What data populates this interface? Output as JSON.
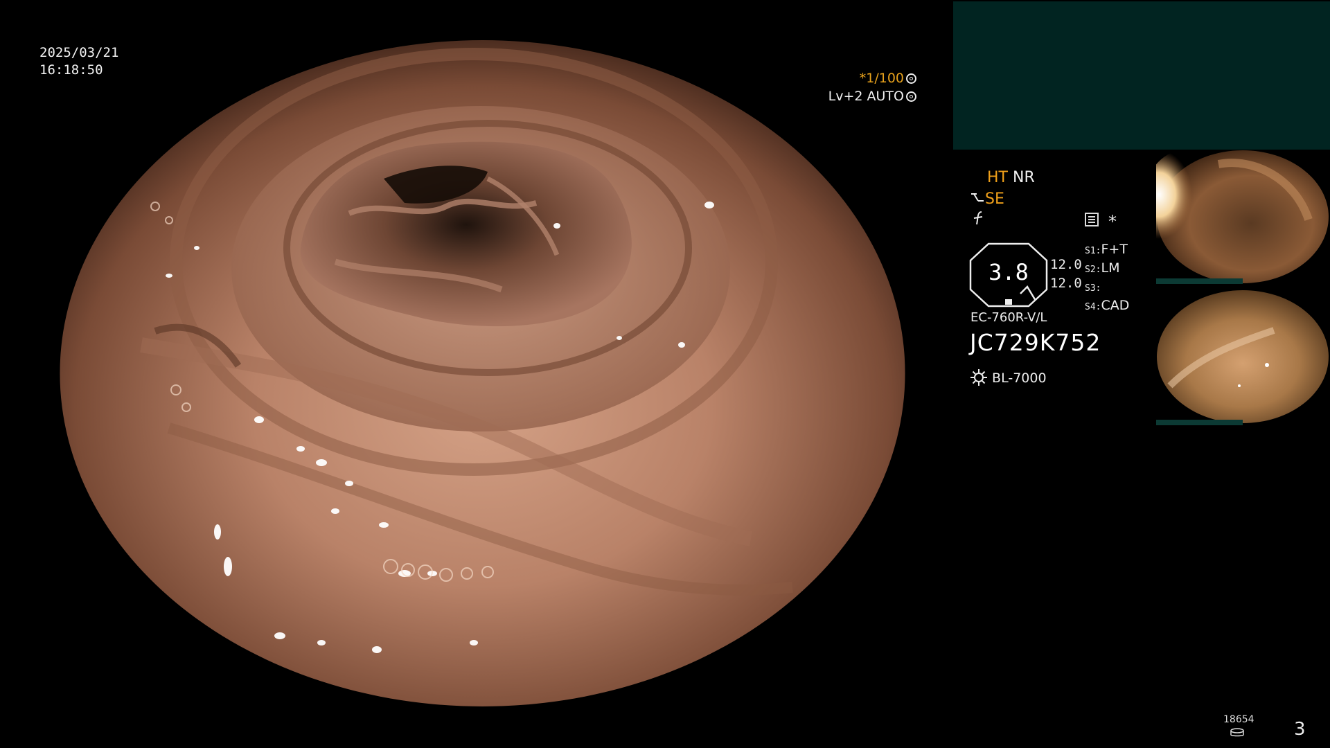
{
  "overlay": {
    "date": "2025/03/21",
    "time": "16:18:50",
    "shutter": "*1/100",
    "level": "Lv+2",
    "mode": "AUTO"
  },
  "settings": {
    "ht": "HT",
    "nr": "NR",
    "se": "SE",
    "star": "*",
    "octagon_value": "3.8",
    "num_top": "12.0",
    "num_bottom": "12.0",
    "s_labels": [
      "S1:",
      "S2:",
      "S3:",
      "S4:"
    ],
    "s_values": [
      "F+T",
      "LM",
      "",
      "CAD"
    ],
    "scope_model": "EC-760R-V/L",
    "scope_serial": "JC729K752",
    "light_source": "BL-7000"
  },
  "footer": {
    "counter": "18654",
    "page": "3"
  },
  "colors": {
    "accent_orange": "#f0a01a",
    "panel_teal": "#012421",
    "mucosa": "#b98268"
  },
  "icons": [
    "shutter-circle-icon",
    "auto-circle-icon",
    "se-icon",
    "f-icon",
    "config-icon",
    "light-source-icon",
    "disk-icon"
  ]
}
